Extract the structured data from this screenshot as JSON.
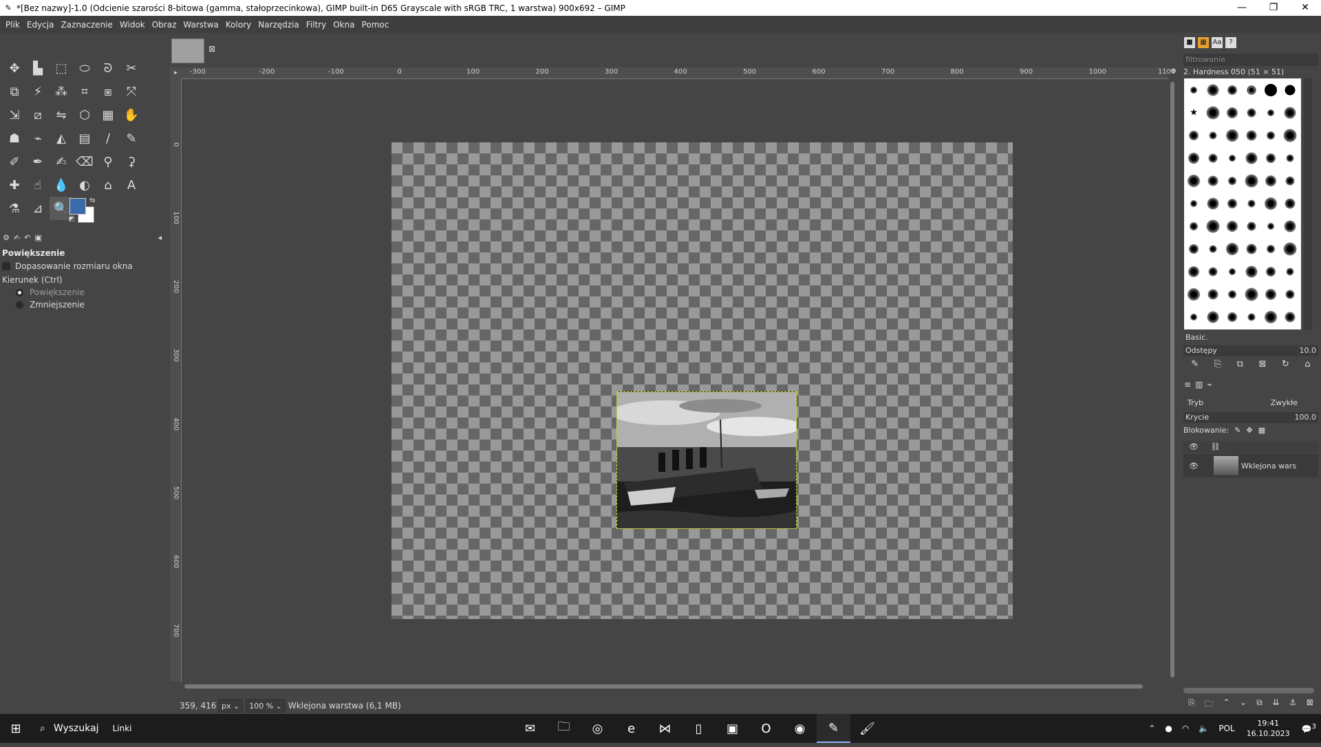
{
  "window": {
    "title": "*[Bez nazwy]-1.0 (Odcienie szarości 8-bitowa (gamma, stałoprzecinkowa), GIMP built-in D65 Grayscale with sRGB TRC, 1 warstwa) 900x692 – GIMP",
    "minimize": "—",
    "maximize": "❐",
    "close": "✕"
  },
  "menu": [
    "Plik",
    "Edycja",
    "Zaznaczenie",
    "Widok",
    "Obraz",
    "Warstwa",
    "Kolory",
    "Narzędzia",
    "Filtry",
    "Okna",
    "Pomoc"
  ],
  "toolbox": {
    "tools": [
      {
        "name": "move-tool",
        "glyph": "✥"
      },
      {
        "name": "align-tool",
        "glyph": "▙"
      },
      {
        "name": "rect-select-tool",
        "glyph": "⬚"
      },
      {
        "name": "ellipse-select-tool",
        "glyph": "⬭"
      },
      {
        "name": "free-select-tool",
        "glyph": "ᘐ"
      },
      {
        "name": "scissors-tool",
        "glyph": "✂"
      },
      {
        "name": "foreground-select-tool",
        "glyph": "⧉"
      },
      {
        "name": "fuzzy-select-tool",
        "glyph": "⚡"
      },
      {
        "name": "by-color-select-tool",
        "glyph": "⁂"
      },
      {
        "name": "crop-tool",
        "glyph": "⌗"
      },
      {
        "name": "unified-transform-tool",
        "glyph": "⧆"
      },
      {
        "name": "warp-tool",
        "glyph": "⤧"
      },
      {
        "name": "scale-tool",
        "glyph": "⇲"
      },
      {
        "name": "shear-tool",
        "glyph": "⧄"
      },
      {
        "name": "flip-tool",
        "glyph": "⇋"
      },
      {
        "name": "perspective-tool",
        "glyph": "⬡"
      },
      {
        "name": "3d-transform-tool",
        "glyph": "▦"
      },
      {
        "name": "handle-transform-tool",
        "glyph": "✋"
      },
      {
        "name": "cage-transform-tool",
        "glyph": "☗"
      },
      {
        "name": "path-tool",
        "glyph": "⌁"
      },
      {
        "name": "bucket-fill-tool",
        "glyph": "◭"
      },
      {
        "name": "gradient-tool",
        "glyph": "▤"
      },
      {
        "name": "paintbrush-tool",
        "glyph": "∕"
      },
      {
        "name": "pencil-tool",
        "glyph": "✎"
      },
      {
        "name": "airbrush-tool",
        "glyph": "✐"
      },
      {
        "name": "ink-tool",
        "glyph": "✒"
      },
      {
        "name": "mypaint-brush-tool",
        "glyph": "✍"
      },
      {
        "name": "eraser-tool",
        "glyph": "⌫"
      },
      {
        "name": "clone-tool",
        "glyph": "⚲"
      },
      {
        "name": "perspective-clone-tool",
        "glyph": "⚳"
      },
      {
        "name": "heal-tool",
        "glyph": "✚"
      },
      {
        "name": "smudge-tool",
        "glyph": "☝"
      },
      {
        "name": "blur-tool",
        "glyph": "💧"
      },
      {
        "name": "dodge-burn-tool",
        "glyph": "◐"
      },
      {
        "name": "paths-tool",
        "glyph": "⌂"
      },
      {
        "name": "text-tool",
        "glyph": "A"
      },
      {
        "name": "color-picker-tool",
        "glyph": "⚗"
      },
      {
        "name": "measure-tool",
        "glyph": "⊿"
      },
      {
        "name": "zoom-tool",
        "glyph": "🔍"
      }
    ],
    "options": {
      "title": "Powiększenie",
      "resize_window": "Dopasowanie rozmiaru okna",
      "direction_label": "Kierunek  (Ctrl)",
      "zoom_in": "Powiększenie",
      "zoom_out": "Zmniejszenie"
    },
    "colors": {
      "foreground": "#3b6aa8",
      "background": "#ffffff"
    }
  },
  "rulers": {
    "horizontal": [
      "-300",
      "-200",
      "-100",
      "0",
      "100",
      "200",
      "300",
      "400",
      "500",
      "600",
      "700",
      "800",
      "900",
      "1000",
      "1100"
    ],
    "vertical": [
      "0",
      "100",
      "200",
      "300",
      "400",
      "500",
      "600",
      "700"
    ]
  },
  "status": {
    "coords": "359, 416",
    "unit": "px",
    "zoom": "100 %",
    "layer_info": "Wklejona warstwa (6,1 MB)"
  },
  "dock": {
    "filter_placeholder": "filtrowanie",
    "brush_name": "2. Hardness 050 (51 × 51)",
    "brush_tag": "Basic.",
    "spacing_label": "Odstępy",
    "spacing_value": "10.0",
    "mode_label": "Tryb",
    "mode_value": "Zwykłe",
    "opacity_label": "Krycie",
    "opacity_value": "100.0",
    "lock_label": "Blokowanie:",
    "layer_name": "Wklejona wars"
  },
  "taskbar": {
    "search_label": "Wyszukaj",
    "links_label": "Linki",
    "language": "POL",
    "time": "19:41",
    "date": "16.10.2023",
    "notifications": "3"
  }
}
